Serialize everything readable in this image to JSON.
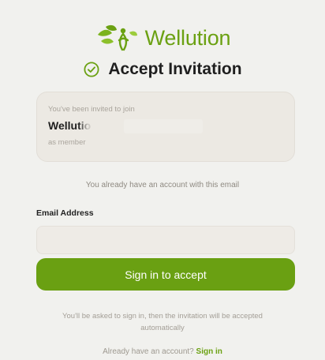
{
  "brand": {
    "name": "Wellution",
    "accent_color": "#6ba112",
    "logo_icon": "leaf-figure-icon"
  },
  "header": {
    "title": "Accept Invitation",
    "title_icon": "check-circle-icon"
  },
  "invite": {
    "intro": "You've been invited to join",
    "organization": "Wellutio",
    "role": "as member"
  },
  "notice": {
    "existing_account": "You already have an account with this email"
  },
  "form": {
    "email_label": "Email Address",
    "email_value": "",
    "email_placeholder": "",
    "submit_label": "Sign in to accept"
  },
  "helper": {
    "text": "You'll be asked to sign in, then the invitation will be accepted automatically"
  },
  "footer": {
    "prompt": "Already have an account? ",
    "link_label": "Sign in"
  }
}
